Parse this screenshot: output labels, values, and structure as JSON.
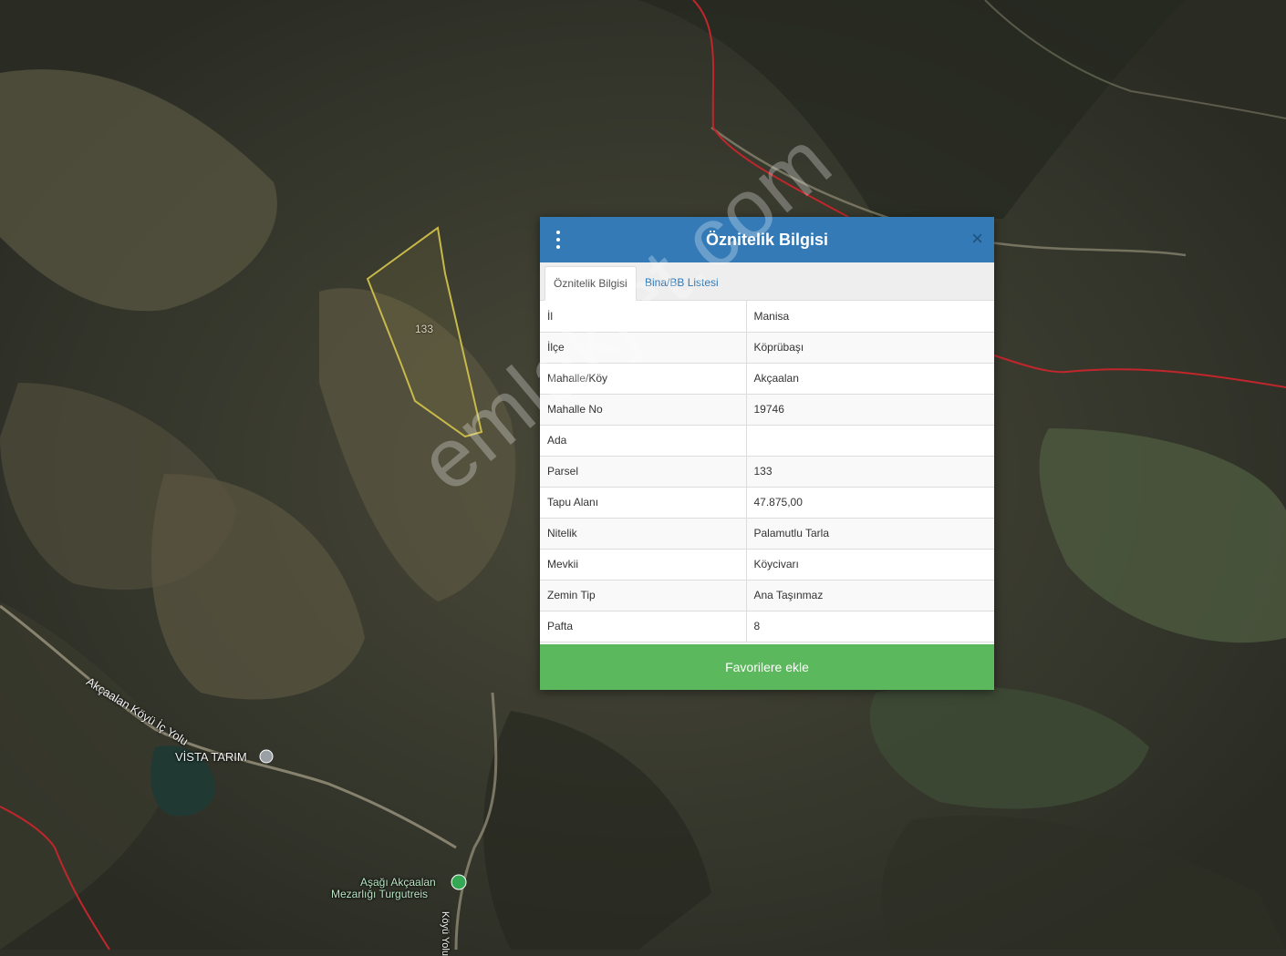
{
  "dialog": {
    "title": "Öznitelik Bilgisi",
    "tabs": [
      {
        "label": "Öznitelik Bilgisi",
        "active": true
      },
      {
        "label": "Bina/BB Listesi",
        "active": false
      }
    ],
    "rows": [
      {
        "key": "İl",
        "value": "Manisa"
      },
      {
        "key": "İlçe",
        "value": "Köprübaşı"
      },
      {
        "key": "Mahalle/Köy",
        "value": "Akçaalan"
      },
      {
        "key": "Mahalle No",
        "value": "19746"
      },
      {
        "key": "Ada",
        "value": ""
      },
      {
        "key": "Parsel",
        "value": "133"
      },
      {
        "key": "Tapu Alanı",
        "value": "47.875,00"
      },
      {
        "key": "Nitelik",
        "value": "Palamutlu Tarla"
      },
      {
        "key": "Mevkii",
        "value": "Köycivarı"
      },
      {
        "key": "Zemin Tip",
        "value": "Ana Taşınmaz"
      },
      {
        "key": "Pafta",
        "value": "8"
      }
    ],
    "favorite_label": "Favorilere ekle",
    "menu_icon": "vertical-dots-icon",
    "close_icon": "close-icon",
    "header_color": "#337ab7",
    "button_color": "#5cb85c"
  },
  "map": {
    "parcel_label": "133",
    "road_label": "Akçaalan Köyü İç Yolu",
    "road_label_2": "Köyü Yolu",
    "poi_label": "VİSTA TARIM",
    "cemetery_label_line1": "Aşağı Akçaalan",
    "cemetery_label_line2": "Mezarlığı Turgutreis",
    "boundary_color": "#c0262b",
    "parcel_outline_color": "#c8b94a"
  },
  "watermark": "emlakjet.com"
}
